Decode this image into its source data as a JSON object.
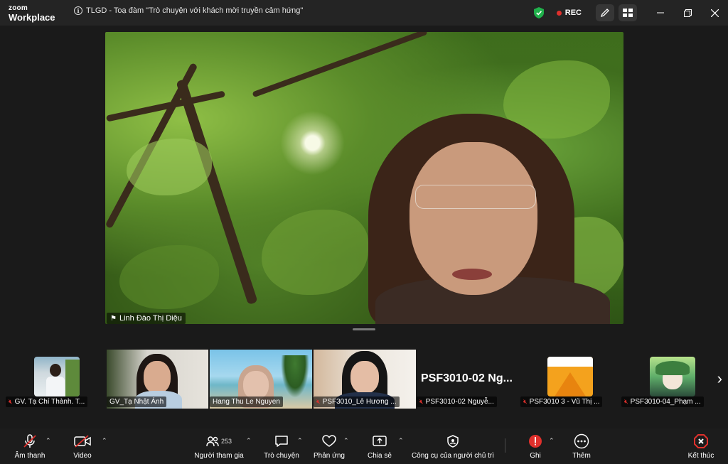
{
  "app": {
    "logo_top": "zoom",
    "logo_bottom": "Workplace"
  },
  "meeting": {
    "title": "TLGD - Toạ đàm \"Trò chuyện với khách mời truyền cảm hứng\""
  },
  "header": {
    "rec_label": "REC"
  },
  "main_video": {
    "speaker_name": "Linh Đào Thị Diệu"
  },
  "participants": [
    {
      "label": "GV. Tạ Chí Thành. T...",
      "muted": true
    },
    {
      "label": "GV_Tạ Nhật Ánh",
      "muted": false
    },
    {
      "label": "Hang Thu Le Nguyen",
      "muted": false
    },
    {
      "label": "PSF3010_Lê Hương ...",
      "muted": true
    },
    {
      "label": "PSF3010-02 Nguyễ...",
      "muted": true,
      "display_name": "PSF3010-02  Ng..."
    },
    {
      "label": "PSF3010 3 - Vũ Thị ...",
      "muted": true
    },
    {
      "label": "PSF3010-04_Phạm ...",
      "muted": true
    }
  ],
  "toolbar": {
    "audio": "Âm thanh",
    "video": "Video",
    "participants": "Người tham gia",
    "participants_count": "253",
    "chat": "Trò chuyện",
    "reactions": "Phản ứng",
    "share": "Chia sẻ",
    "host_tools": "Công cụ của người chủ trì",
    "notes": "Ghi",
    "more": "Thêm",
    "end": "Kết thúc"
  },
  "colors": {
    "accent_red": "#e0302c",
    "shield_green": "#20b04b",
    "background": "#1a1a1a"
  }
}
